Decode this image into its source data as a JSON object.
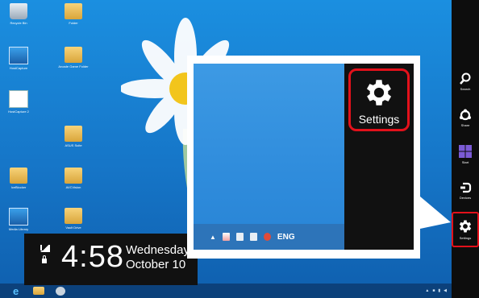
{
  "desktop": {
    "icons": [
      {
        "label": "Recycle Bin",
        "kind": "bin"
      },
      {
        "label": "Folder",
        "kind": "folder"
      },
      {
        "label": "HostCapture",
        "kind": "app"
      },
      {
        "label": "Arcade Game Folder",
        "kind": "folder"
      },
      {
        "label": "HostCapture 2",
        "kind": "doc"
      },
      {
        "label": "ASUS Suite",
        "kind": "folder"
      },
      {
        "label": "IceBlocker",
        "kind": "folder"
      },
      {
        "label": "AVCVision",
        "kind": "folder"
      },
      {
        "label": "Media Library",
        "kind": "app"
      },
      {
        "label": "Vault Drive",
        "kind": "folder"
      }
    ]
  },
  "clock": {
    "time": "4:58",
    "day": "Wednesday",
    "date": "October 10"
  },
  "charms": [
    {
      "label": "Search",
      "icon": "search-icon"
    },
    {
      "label": "Share",
      "icon": "share-icon"
    },
    {
      "label": "Start",
      "icon": "windows-logo-icon"
    },
    {
      "label": "Devices",
      "icon": "devices-icon"
    },
    {
      "label": "Settings",
      "icon": "gear-icon"
    }
  ],
  "zoom": {
    "settings_label": "Settings",
    "tray_language": "ENG"
  },
  "colors": {
    "highlight": "#e3111b",
    "desktop_blue": "#1676c8",
    "charm_bar": "#0d0d0d"
  }
}
